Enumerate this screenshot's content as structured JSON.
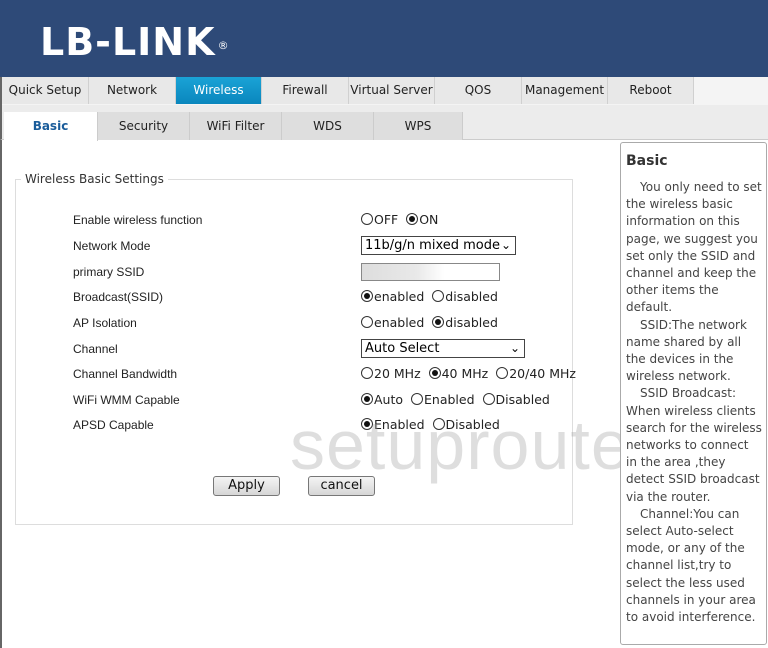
{
  "header": {
    "logo_text": "LB-LINK",
    "logo_mark": "®"
  },
  "main_nav": {
    "active": "Wireless",
    "items": [
      {
        "label": "Quick Setup"
      },
      {
        "label": "Network"
      },
      {
        "label": "Wireless"
      },
      {
        "label": "Firewall"
      },
      {
        "label": "Virtual Server"
      },
      {
        "label": "QOS"
      },
      {
        "label": "Management"
      },
      {
        "label": "Reboot"
      }
    ]
  },
  "sub_nav": {
    "active": "Basic",
    "items": [
      {
        "label": "Basic"
      },
      {
        "label": "Security"
      },
      {
        "label": "WiFi Filter"
      },
      {
        "label": "WDS"
      },
      {
        "label": "WPS"
      }
    ]
  },
  "form": {
    "legend": "Wireless Basic Settings",
    "enable_wireless": {
      "label": "Enable wireless function",
      "options": [
        "OFF",
        "ON"
      ],
      "selected": "ON"
    },
    "network_mode": {
      "label": "Network Mode",
      "value": "11b/g/n mixed mode"
    },
    "primary_ssid": {
      "label": "primary SSID",
      "value": ""
    },
    "broadcast_ssid": {
      "label": "Broadcast(SSID)",
      "options": [
        "enabled",
        "disabled"
      ],
      "selected": "enabled"
    },
    "ap_isolation": {
      "label": "AP Isolation",
      "options": [
        "enabled",
        "disabled"
      ],
      "selected": "disabled"
    },
    "channel": {
      "label": "Channel",
      "value": "Auto Select"
    },
    "channel_bandwidth": {
      "label": "Channel Bandwidth",
      "options": [
        "20 MHz",
        "40 MHz",
        "20/40 MHz"
      ],
      "selected": "40 MHz"
    },
    "wmm": {
      "label": "WiFi WMM Capable",
      "options": [
        "Auto",
        "Enabled",
        "Disabled"
      ],
      "selected": "Auto"
    },
    "apsd": {
      "label": "APSD Capable",
      "options": [
        "Enabled",
        "Disabled"
      ],
      "selected": "Enabled"
    },
    "apply_label": "Apply",
    "cancel_label": "cancel"
  },
  "help": {
    "title": "Basic",
    "paragraphs": [
      "You only need to set the wireless basic information on this page, we suggest you set only the SSID and channel and keep the other items the default.",
      "SSID:The network name shared by all the devices in the wireless network.",
      "SSID Broadcast: When wireless clients search for the wireless networks to connect in the area ,they detect SSID broadcast via the router.",
      "Channel:You can select Auto-select mode, or any of the channel list,try to select the less used channels in your area to avoid interference."
    ]
  },
  "watermark": "setuprouter"
}
